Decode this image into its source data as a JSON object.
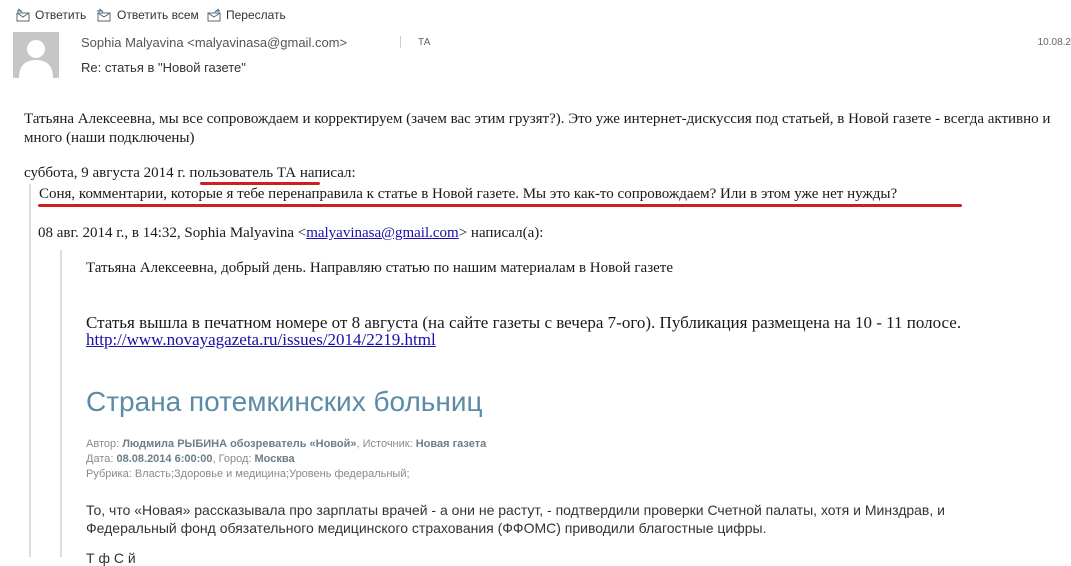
{
  "toolbar": {
    "reply": "Ответить",
    "reply_all": "Ответить всем",
    "forward": "Переслать"
  },
  "header": {
    "sender": "Sophia Malyavina <malyavinasa@gmail.com>",
    "to": "ТА",
    "date": "10.08.2",
    "subject": "Re: статья в \"Новой газете\""
  },
  "reply": {
    "text": "Татьяна Алексеевна, мы все сопровождаем и корректируем (зачем вас этим грузят?). Это уже интернет-дискуссия под статьей, в Новой газете - всегда активно и много (наши подключены)"
  },
  "attribution1": {
    "prefix": "суббота, 9 августа 2014 г. ",
    "user": "пользователь ТА",
    "suffix": " написал:"
  },
  "quote1": {
    "text": "Соня, комментарии, которые я тебе перенаправила к статье в Новой газете. Мы это как-то сопровождаем? Или в этом уже нет нужды?"
  },
  "attribution2": {
    "prefix": "08 авг. 2014 г., в 14:32, Sophia Malyavina <",
    "email": "malyavinasa@gmail.com",
    "suffix": "> написал(а):"
  },
  "inner": {
    "greeting": "Татьяна Алексеевна, добрый день. Направляю статью по нашим материалам в Новой газете",
    "published": "Статья вышла в печатном номере от 8 августа (на сайте газеты с вечера 7-ого). Публикация размещена на 10 - 11 полосе.",
    "link": "http://www.novayagazeta.ru/issues/2014/2219.html"
  },
  "article": {
    "title": "Страна потемкинских больниц",
    "author_label": "Автор: ",
    "author": "Людмила РЫБИНА обозреватель «Новой»",
    "source_label": ",  Источник: ",
    "source": "Новая газета",
    "date_label": "Дата: ",
    "date": "08.08.2014 6:00:00",
    "city_label": ",  Город: ",
    "city": "Москва",
    "rubric_label": "Рубрика: ",
    "rubric": "Власть;Здоровье и медицина;Уровень федеральный;",
    "body": "То, что «Новая» рассказывала про зарплаты врачей - а они не растут, - подтвердили проверки Счетной палаты, хотя и Минздрав, и Федеральный фонд обязательного медицинского страхования (ФФОМС) приводили благостные цифры.",
    "cut": "Т                    ф                    С      й"
  },
  "colors": {
    "underline_red": "#cc1f1f",
    "article_title": "#5b8ba6",
    "link": "#1a0dab"
  }
}
